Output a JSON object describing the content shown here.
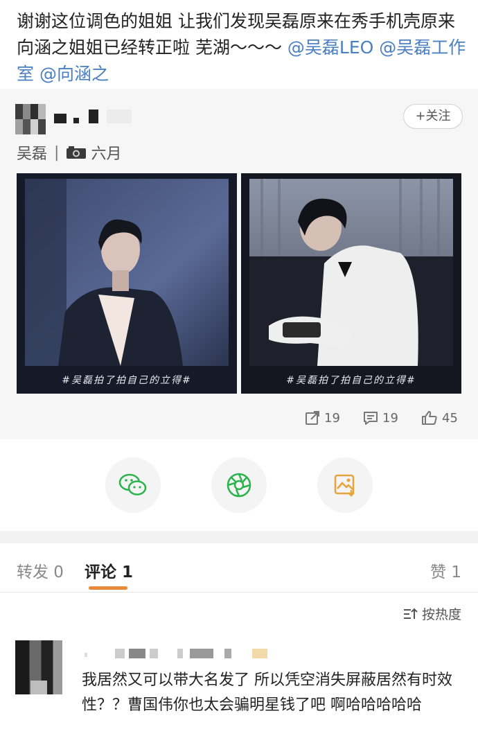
{
  "post": {
    "text_plain": "谢谢这位调色的姐姐 让我们发现吴磊原来在秀手机壳原来向涵之姐姐已经转正啦 芜湖～～～",
    "mention_1": "@吴磊LEO",
    "mention_2": "@吴磊工作室",
    "mention_3": "@向涵之"
  },
  "repost": {
    "follow_label": "+关注",
    "sub_name": "吴磊",
    "sub_separator": "|",
    "sub_tag": "六月",
    "photo_caption_1": "#吴磊拍了拍自己的立得#",
    "photo_caption_2": "#吴磊拍了拍自己的立得#",
    "repost_count": "19",
    "comment_count": "19",
    "like_count": "45"
  },
  "share": {
    "wechat_icon": "wechat-icon",
    "moments_icon": "moments-icon",
    "save_image_icon": "save-image-icon"
  },
  "tabs": {
    "repost_label": "转发 0",
    "comment_label": "评论 1",
    "like_label": "赞 1"
  },
  "sort_label": "按热度",
  "comment": {
    "text": "我居然又可以带大名发了 所以凭空消失屏蔽居然有时效性？？曹国伟你也太会骗明星钱了吧 啊哈哈哈哈哈"
  },
  "colors": {
    "mention": "#4a7fc1",
    "accent": "#e88a3a",
    "wechat_green": "#2ab24c"
  }
}
